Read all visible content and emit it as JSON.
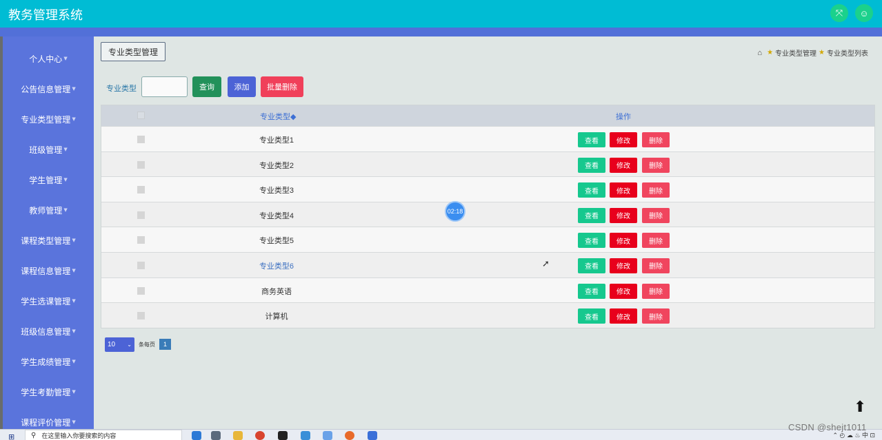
{
  "app": {
    "title": "教务管理系统"
  },
  "header": {
    "icons": [
      "fullscreen-icon",
      "user-icon"
    ]
  },
  "sidebar": {
    "items": [
      {
        "label": "个人中心"
      },
      {
        "label": "公告信息管理"
      },
      {
        "label": "专业类型管理"
      },
      {
        "label": "班级管理"
      },
      {
        "label": "学生管理"
      },
      {
        "label": "教师管理"
      },
      {
        "label": "课程类型管理"
      },
      {
        "label": "课程信息管理"
      },
      {
        "label": "学生选课管理"
      },
      {
        "label": "班级信息管理"
      },
      {
        "label": "学生成绩管理"
      },
      {
        "label": "学生考勤管理"
      },
      {
        "label": "课程评价管理"
      }
    ]
  },
  "page": {
    "title": "专业类型管理",
    "breadcrumb": [
      "专业类型管理",
      "专业类型列表"
    ]
  },
  "search": {
    "label": "专业类型",
    "value": "",
    "query_label": "查询",
    "add_label": "添加",
    "batch_delete_label": "批量删除"
  },
  "table": {
    "headers": {
      "name": "专业类型◆",
      "ops": "操作"
    },
    "rows": [
      {
        "name": "专业类型1"
      },
      {
        "name": "专业类型2"
      },
      {
        "name": "专业类型3"
      },
      {
        "name": "专业类型4"
      },
      {
        "name": "专业类型5"
      },
      {
        "name": "专业类型6"
      },
      {
        "name": "商务英语"
      },
      {
        "name": "计算机"
      }
    ],
    "actions": {
      "view": "查看",
      "edit": "修改",
      "delete": "删除"
    }
  },
  "pagination": {
    "page_size": "10",
    "per_page_label": "条每页",
    "current_page": "1"
  },
  "overlay": {
    "timer": "02:18"
  },
  "taskbar": {
    "search_placeholder": "在这里输入你要搜索的内容"
  },
  "watermark": "CSDN @shejt1011",
  "colors": {
    "topbar": "#00bcd4",
    "sidebar": "#5a74dc",
    "query": "#22915a",
    "add": "#4c63d6",
    "batch_delete": "#f0405a",
    "view": "#16c88e",
    "edit": "#e8001c",
    "delete": "#f0455e"
  }
}
